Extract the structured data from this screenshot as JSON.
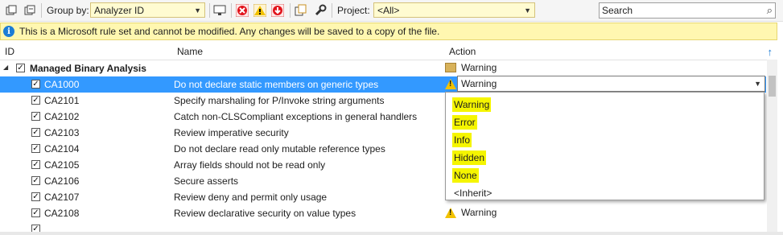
{
  "toolbar": {
    "group_by_label": "Group by:",
    "group_by_value": "Analyzer ID",
    "project_label": "Project:",
    "project_value": "<All>",
    "search_placeholder": "Search"
  },
  "infobar": {
    "message": "This is a Microsoft rule set and cannot be modified. Any changes will be saved to a copy of the file."
  },
  "columns": {
    "id": "ID",
    "name": "Name",
    "action": "Action"
  },
  "group": {
    "label": "Managed Binary Analysis",
    "action": "Warning"
  },
  "rules": [
    {
      "id": "CA1000",
      "name": "Do not declare static members on generic types"
    },
    {
      "id": "CA2101",
      "name": "Specify marshaling for P/Invoke string arguments"
    },
    {
      "id": "CA2102",
      "name": "Catch non-CLSCompliant exceptions in general handlers"
    },
    {
      "id": "CA2103",
      "name": "Review imperative security"
    },
    {
      "id": "CA2104",
      "name": "Do not declare read only mutable reference types"
    },
    {
      "id": "CA2105",
      "name": "Array fields should not be read only"
    },
    {
      "id": "CA2106",
      "name": "Secure asserts"
    },
    {
      "id": "CA2107",
      "name": "Review deny and permit only usage"
    },
    {
      "id": "CA2108",
      "name": "Review declarative security on value types",
      "action": "Warning"
    }
  ],
  "selected_action": "Warning",
  "dropdown_options": [
    "Warning",
    "Error",
    "Info",
    "Hidden",
    "None",
    "<Inherit>"
  ],
  "colors": {
    "selection": "#3399ff",
    "highlight": "#f5f500",
    "infobar": "#fff7b0"
  }
}
